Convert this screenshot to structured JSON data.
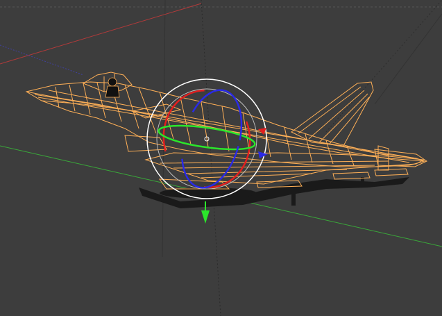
{
  "viewport": {
    "mode": "wireframe",
    "selected_object": "fighter-jet",
    "active_manipulator": "rotate"
  },
  "colors": {
    "background": "#3d3d3d",
    "grid_lines": "#4a4a4a",
    "wireframe_selected": "#ffb057",
    "x_axis": "#b23a3a",
    "y_axis": "#3aa83a",
    "z_axis": "#303080",
    "rotate_x": "#e21f1f",
    "rotate_y": "#2be62b",
    "rotate_z": "#2a2ae6",
    "gizmo_view_ring": "#ffffff",
    "gizmo_outer_ring": "#bfbfbf"
  },
  "icons": {
    "rotate_gizmo": "rotate-manipulator-icon",
    "translate_arrow": "translate-arrow-icon"
  }
}
